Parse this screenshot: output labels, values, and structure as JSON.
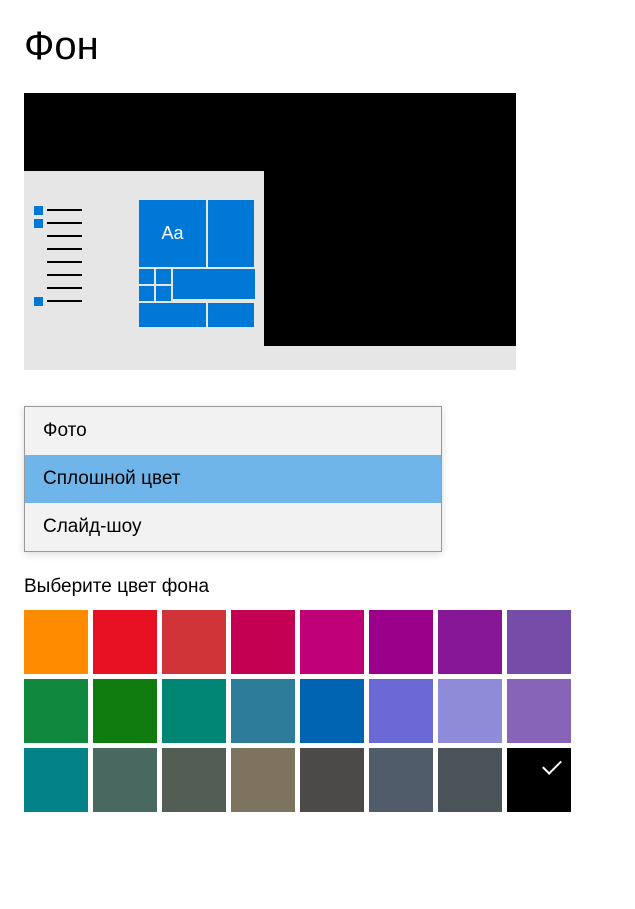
{
  "title": "Фон",
  "preview": {
    "sample_text": "Aa"
  },
  "dropdown": {
    "options": [
      {
        "label": "Фото",
        "selected": false
      },
      {
        "label": "Сплошной цвет",
        "selected": true
      },
      {
        "label": "Слайд-шоу",
        "selected": false
      }
    ]
  },
  "color_section_label": "Выберите цвет фона",
  "colors": [
    {
      "hex": "#ff8c00",
      "selected": false
    },
    {
      "hex": "#e81123",
      "selected": false
    },
    {
      "hex": "#d13438",
      "selected": false
    },
    {
      "hex": "#c30052",
      "selected": false
    },
    {
      "hex": "#bf0077",
      "selected": false
    },
    {
      "hex": "#9a0089",
      "selected": false
    },
    {
      "hex": "#881798",
      "selected": false
    },
    {
      "hex": "#744da9",
      "selected": false
    },
    {
      "hex": "#10893e",
      "selected": false
    },
    {
      "hex": "#107c10",
      "selected": false
    },
    {
      "hex": "#018574",
      "selected": false
    },
    {
      "hex": "#2d7d9a",
      "selected": false
    },
    {
      "hex": "#0063b1",
      "selected": false
    },
    {
      "hex": "#6b69d6",
      "selected": false
    },
    {
      "hex": "#8e8cd8",
      "selected": false
    },
    {
      "hex": "#8764b8",
      "selected": false
    },
    {
      "hex": "#038387",
      "selected": false
    },
    {
      "hex": "#486860",
      "selected": false
    },
    {
      "hex": "#525e54",
      "selected": false
    },
    {
      "hex": "#7e735f",
      "selected": false
    },
    {
      "hex": "#4c4a48",
      "selected": false
    },
    {
      "hex": "#515c6b",
      "selected": false
    },
    {
      "hex": "#4a5459",
      "selected": false
    },
    {
      "hex": "#000000",
      "selected": true
    }
  ]
}
